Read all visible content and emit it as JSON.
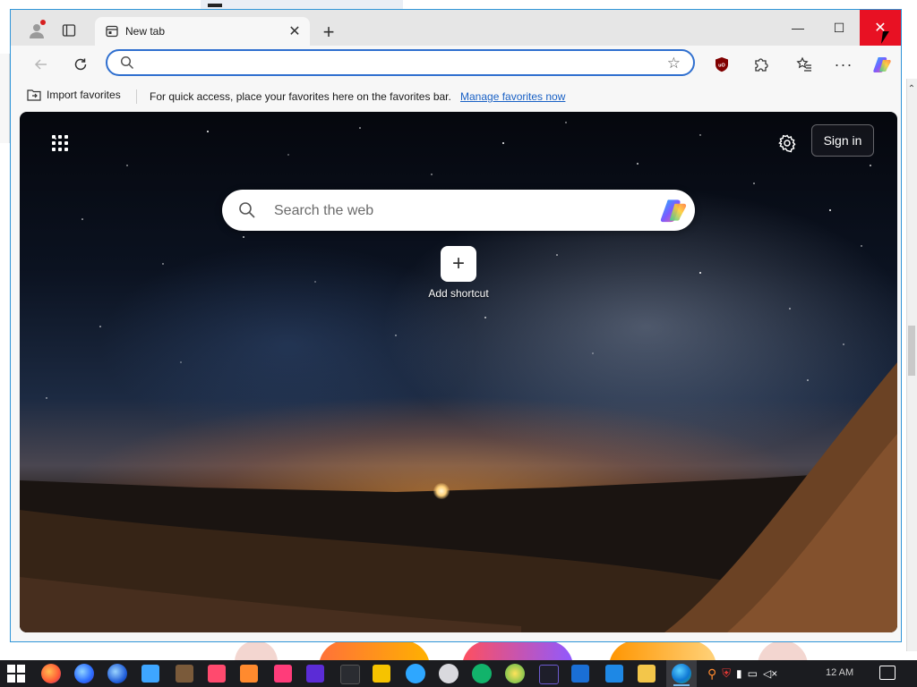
{
  "browser": {
    "tab": {
      "title": "New tab",
      "close_label": "✕"
    },
    "new_tab_label": "+",
    "window_controls": {
      "minimize": "—",
      "maximize": "☐",
      "close": "✕"
    },
    "address_bar": {
      "value": "",
      "placeholder": ""
    },
    "toolbar": {
      "more_label": "···"
    }
  },
  "favorites_bar": {
    "import_label": "Import favorites",
    "message": "For quick access, place your favorites here on the favorites bar.",
    "link": "Manage favorites now"
  },
  "new_tab_page": {
    "sign_in_label": "Sign in",
    "search": {
      "placeholder": "Search the web"
    },
    "add_shortcut": {
      "icon": "+",
      "label": "Add shortcut"
    }
  },
  "taskbar": {
    "apps": [
      "firefox-icon",
      "firefox-dev-icon",
      "firefox-nightly-icon",
      "waterfox-icon",
      "librewolf-icon",
      "floorp-icon",
      "mercury-icon",
      "vivaldi-icon",
      "zen-icon",
      "mullvad-icon",
      "safari-icon",
      "chrome-icon",
      "chromium-icon",
      "opera-icon",
      "brave-icon",
      "edge-beta-icon",
      "file-explorer-icon",
      "edge-icon"
    ],
    "clock": "12 AM"
  },
  "colors": {
    "accent": "#2f6fcf",
    "window_border": "#2f95d8",
    "close_hover": "#e81123",
    "link": "#1a61c5"
  }
}
